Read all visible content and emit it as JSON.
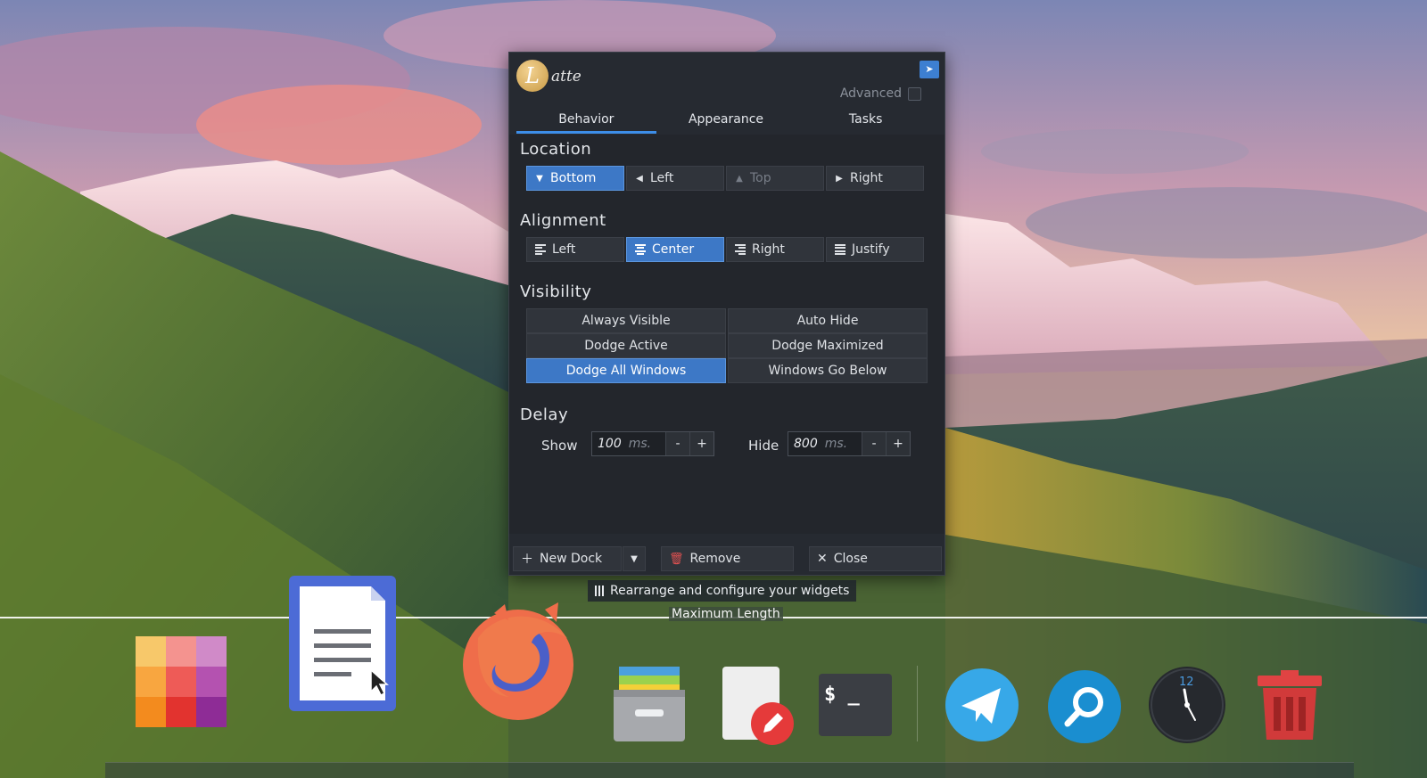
{
  "app": {
    "logo_letter": "L",
    "logo_text": "atte",
    "pin_icon": "pin-icon",
    "advanced_label": "Advanced"
  },
  "tabs": [
    {
      "label": "Behavior",
      "active": true
    },
    {
      "label": "Appearance",
      "active": false
    },
    {
      "label": "Tasks",
      "active": false
    }
  ],
  "location": {
    "title": "Location",
    "options": [
      {
        "label": "Bottom",
        "icon": "triangle-down-icon",
        "state": "active"
      },
      {
        "label": "Left",
        "icon": "triangle-left-icon",
        "state": "normal"
      },
      {
        "label": "Top",
        "icon": "triangle-up-icon",
        "state": "disabled"
      },
      {
        "label": "Right",
        "icon": "triangle-right-icon",
        "state": "normal"
      }
    ]
  },
  "alignment": {
    "title": "Alignment",
    "options": [
      {
        "label": "Left",
        "icon": "align-left-icon",
        "state": "normal"
      },
      {
        "label": "Center",
        "icon": "align-center-icon",
        "state": "active"
      },
      {
        "label": "Right",
        "icon": "align-right-icon",
        "state": "normal"
      },
      {
        "label": "Justify",
        "icon": "align-justify-icon",
        "state": "normal"
      }
    ]
  },
  "visibility": {
    "title": "Visibility",
    "options": [
      {
        "label": "Always Visible",
        "state": "normal"
      },
      {
        "label": "Auto Hide",
        "state": "normal"
      },
      {
        "label": "Dodge Active",
        "state": "normal"
      },
      {
        "label": "Dodge Maximized",
        "state": "normal"
      },
      {
        "label": "Dodge All Windows",
        "state": "active"
      },
      {
        "label": "Windows Go Below",
        "state": "normal"
      }
    ]
  },
  "delay": {
    "title": "Delay",
    "show": {
      "label": "Show",
      "value": "100",
      "unit": "ms.",
      "minus": "-",
      "plus": "+"
    },
    "hide": {
      "label": "Hide",
      "value": "800",
      "unit": "ms.",
      "minus": "-",
      "plus": "+"
    }
  },
  "footer": {
    "new_dock": "New Dock",
    "remove": "Remove",
    "close": "Close"
  },
  "dock": {
    "rearrange_label": "Rearrange and configure your widgets",
    "max_length_label": "Maximum Length",
    "clock_number": "12",
    "terminal_prompt": "$ _",
    "items": [
      "color-palette-icon",
      "writer-document-icon",
      "firefox-icon",
      "file-archive-icon",
      "text-editor-icon",
      "terminal-icon",
      "telegram-icon",
      "search-icon",
      "clock-icon",
      "trash-icon"
    ]
  },
  "colors": {
    "accent": "#3d78c6",
    "tab_underline": "#3d8ee8",
    "dialog_bg": "#262a31"
  }
}
